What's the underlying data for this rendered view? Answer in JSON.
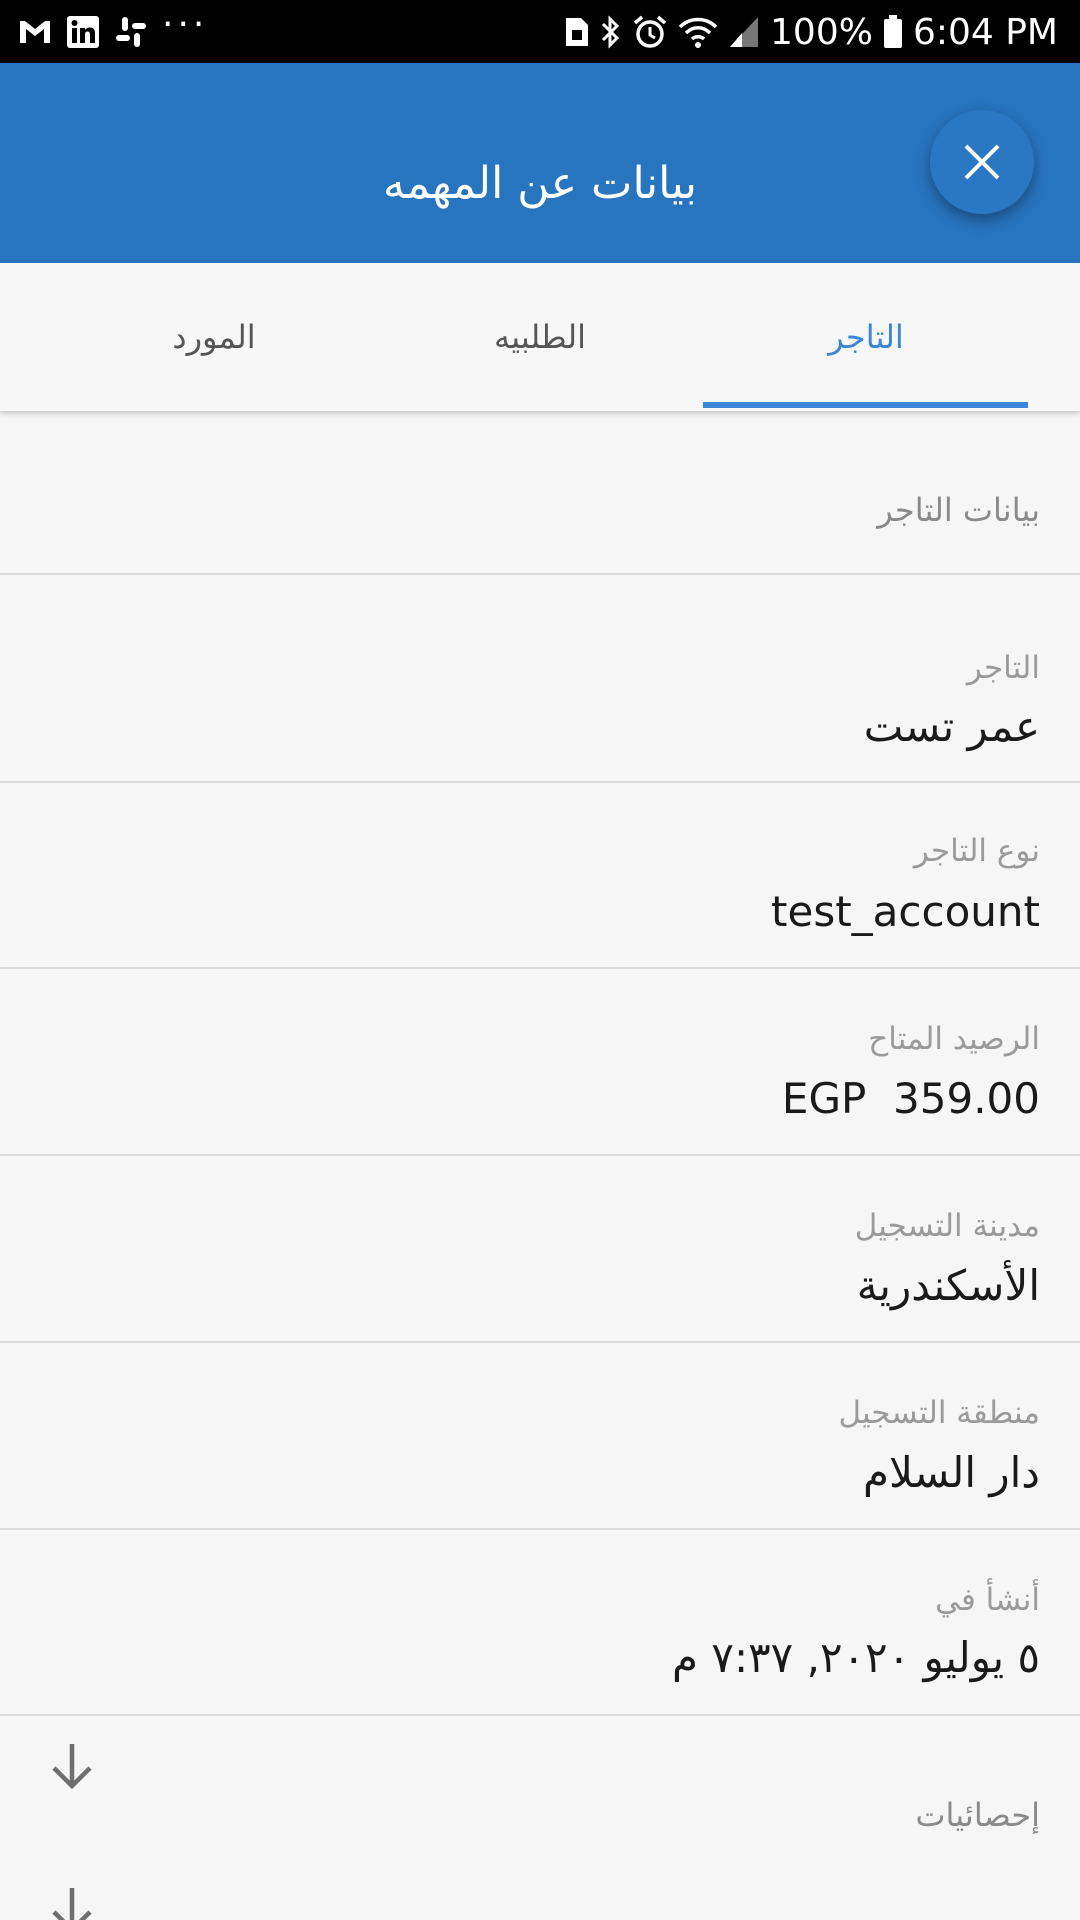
{
  "status_bar": {
    "battery_text": "100%",
    "time": "6:04 PM",
    "left_icons": [
      "gmail-icon",
      "linkedin-icon",
      "slack-icon",
      "more-notifications-icon"
    ],
    "right_icons": [
      "sim-icon",
      "bluetooth-icon",
      "alarm-icon",
      "wifi-icon",
      "signal-icon",
      "battery-icon"
    ],
    "dots": "···"
  },
  "app_bar": {
    "title": "بيانات عن المهمه",
    "close_icon": "close-icon",
    "color": "#2774bf"
  },
  "tabs": [
    {
      "label": "التاجر",
      "active": true
    },
    {
      "label": "الطلبيه",
      "active": false
    },
    {
      "label": "المورد",
      "active": false
    }
  ],
  "accent_color": "#3b86d6",
  "section": {
    "title": "بيانات التاجر"
  },
  "fields": [
    {
      "label": "التاجر",
      "value": "عمر تست"
    },
    {
      "label": "نوع التاجر",
      "value": "test_account"
    },
    {
      "label": "الرصيد المتاح",
      "value": "EGP  359.00"
    },
    {
      "label": "مدينة التسجيل",
      "value": "الأسكندرية"
    },
    {
      "label": "منطقة التسجيل",
      "value": "دار السلام"
    },
    {
      "label": "أنشأ في",
      "value": "٥ يوليو ٢٠٢٠, ٧:٣٧ م"
    }
  ],
  "statistics": {
    "label": "إحصائيات",
    "expand_icon": "arrow-down-icon"
  }
}
